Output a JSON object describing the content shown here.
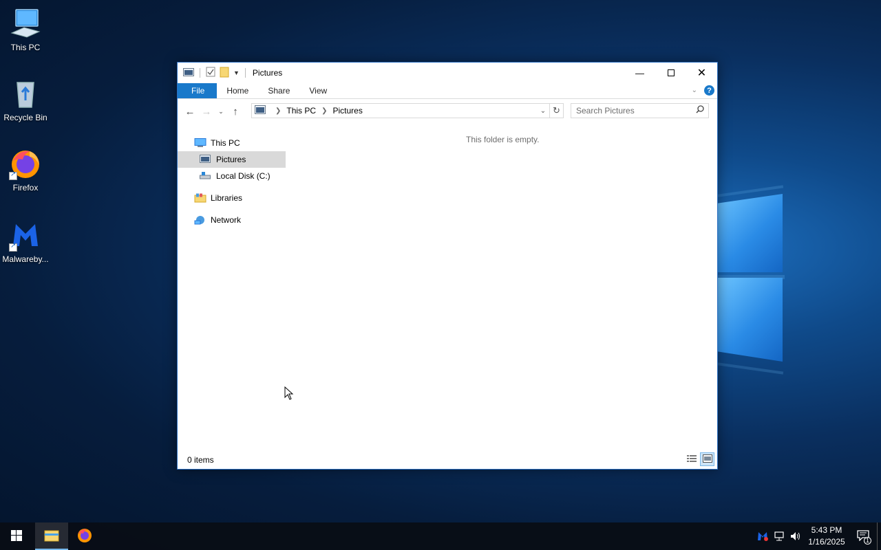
{
  "desktop": {
    "icons": [
      {
        "label": "This PC",
        "icon": "computer-icon"
      },
      {
        "label": "Recycle Bin",
        "icon": "recycle-bin-icon"
      },
      {
        "label": "Firefox",
        "icon": "firefox-icon"
      },
      {
        "label": "Malwareby...",
        "icon": "malwarebytes-icon"
      }
    ]
  },
  "window": {
    "title": "Pictures",
    "ribbon": {
      "tabs": [
        "File",
        "Home",
        "Share",
        "View"
      ],
      "help": "?"
    },
    "address": {
      "crumbs": [
        "This PC",
        "Pictures"
      ]
    },
    "search": {
      "placeholder": "Search Pictures"
    },
    "nav_pane": {
      "items": [
        {
          "label": "This PC",
          "icon": "computer-icon",
          "selected": false
        },
        {
          "label": "Pictures",
          "icon": "pictures-folder-icon",
          "selected": true
        },
        {
          "label": "Local Disk (C:)",
          "icon": "drive-icon",
          "selected": false
        },
        {
          "label": "Libraries",
          "icon": "libraries-icon",
          "selected": false
        },
        {
          "label": "Network",
          "icon": "network-icon",
          "selected": false
        }
      ]
    },
    "content": {
      "empty_message": "This folder is empty."
    },
    "status": {
      "item_count": "0 items"
    }
  },
  "taskbar": {
    "pinned": [
      {
        "name": "file-explorer",
        "active": true
      },
      {
        "name": "firefox",
        "active": false
      }
    ],
    "clock": {
      "time": "5:43 PM",
      "date": "1/16/2025"
    },
    "notification_count": "1"
  },
  "colors": {
    "accent": "#1979ca",
    "selection": "#d9d9d9",
    "taskbar": "#080e16"
  }
}
